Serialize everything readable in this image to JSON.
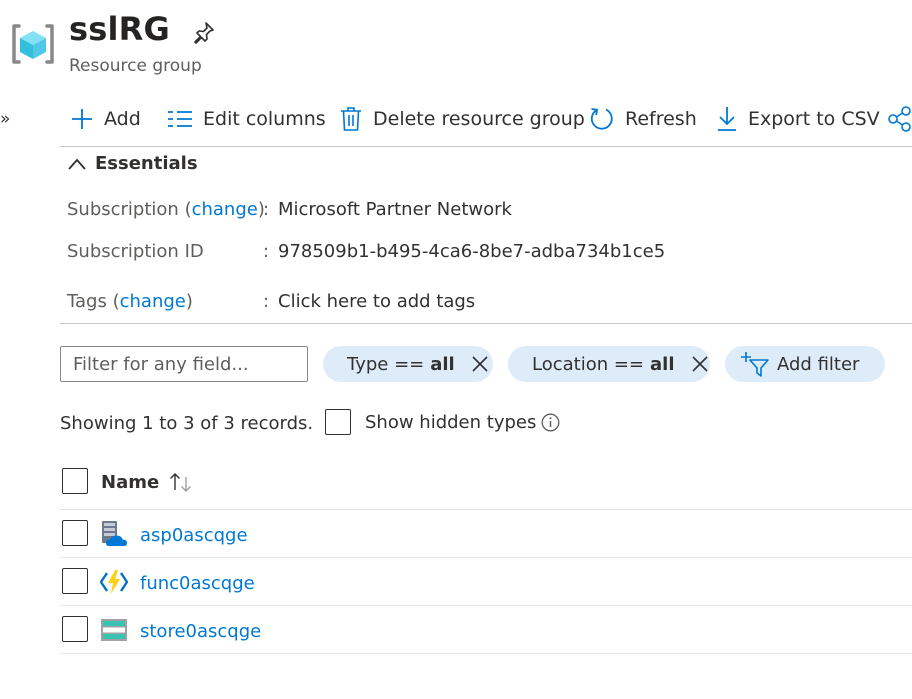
{
  "header": {
    "title": "sslRG",
    "subtitle": "Resource group",
    "icon": "resource-group-icon",
    "pin_icon": "pin-icon"
  },
  "toolbar": {
    "add": "Add",
    "edit_columns": "Edit columns",
    "delete": "Delete resource group",
    "refresh": "Refresh",
    "export": "Export to CSV"
  },
  "essentials": {
    "heading": "Essentials",
    "subscription_label": "Subscription",
    "change": "change",
    "subscription_value": "Microsoft Partner Network",
    "subscription_id_label": "Subscription ID",
    "subscription_id_value": "978509b1-b495-4ca6-8be7-adba734b1ce5",
    "tags_label": "Tags",
    "tags_value": "Click here to add tags",
    "colon": ":"
  },
  "filters": {
    "placeholder": "Filter for any field...",
    "type_prefix": "Type ==",
    "type_value": "all",
    "location_prefix": "Location ==",
    "location_value": "all",
    "add_filter": "Add filter"
  },
  "records": {
    "summary": "Showing 1 to 3 of 3 records.",
    "show_hidden": "Show hidden types"
  },
  "table": {
    "name_header": "Name",
    "rows": [
      {
        "name": "asp0ascqge",
        "icon": "app-service-plan-icon"
      },
      {
        "name": "func0ascqge",
        "icon": "function-app-icon"
      },
      {
        "name": "store0ascqge",
        "icon": "storage-account-icon"
      }
    ]
  },
  "colors": {
    "accent": "#0078d4",
    "pill_bg": "#deecf9",
    "text": "#323130",
    "secondary_text": "#605e5c"
  }
}
